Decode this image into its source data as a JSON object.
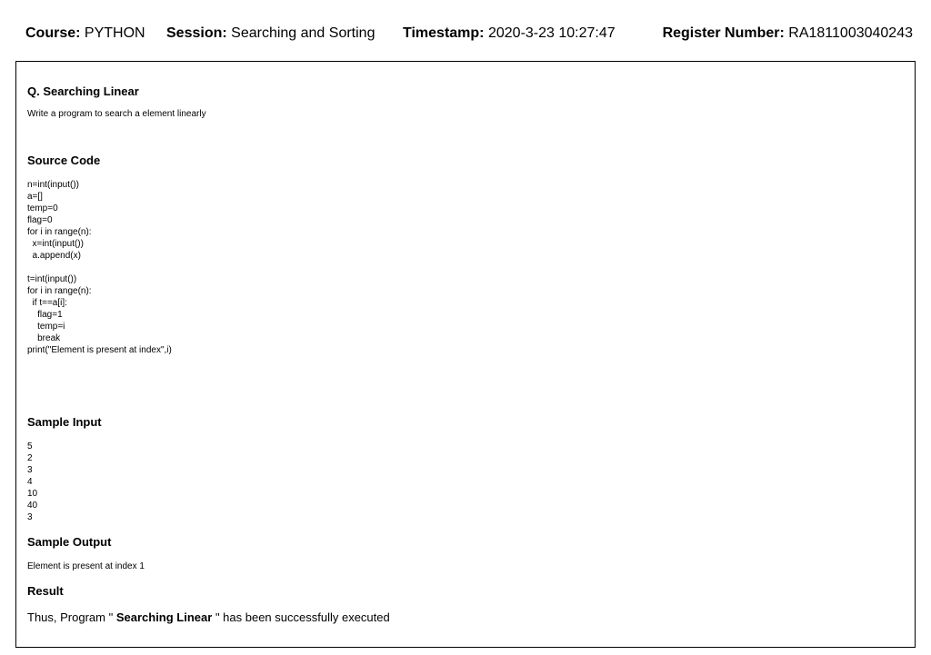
{
  "header": {
    "course_label": "Course:",
    "course_value": "PYTHON",
    "session_label": "Session:",
    "session_value": "Searching and Sorting",
    "timestamp_label": "Timestamp:",
    "timestamp_value": "2020-3-23 10:27:47",
    "register_label": "Register Number:",
    "register_value": "RA1811003040243"
  },
  "question": {
    "title": "Q. Searching Linear",
    "description": "Write a program to search a element linearly"
  },
  "source_code": {
    "heading": "Source Code",
    "lines": [
      "n=int(input())",
      "a=[]",
      "temp=0",
      "flag=0",
      "for i in range(n):",
      "  x=int(input())",
      "  a.append(x)",
      "",
      "t=int(input())",
      "for i in range(n):",
      "  if t==a[i]:",
      "    flag=1",
      "    temp=i",
      "    break",
      "print(\"Element is present at index\",i)"
    ]
  },
  "sample_input": {
    "heading": "Sample Input",
    "lines": [
      "5",
      "2",
      "3",
      "4",
      "10",
      "40",
      "3"
    ]
  },
  "sample_output": {
    "heading": "Sample Output",
    "text": "Element is present at index 1"
  },
  "result": {
    "heading": "Result",
    "prefix": "Thus, Program \"",
    "program_name": "Searching Linear",
    "suffix": "\" has been successfully executed"
  }
}
